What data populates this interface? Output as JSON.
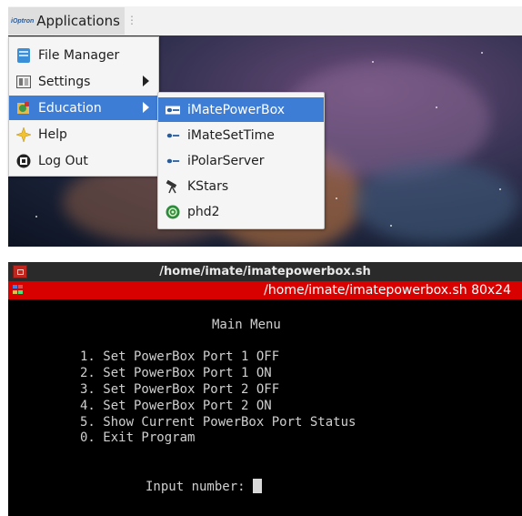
{
  "panel": {
    "logo_text": "iOptron",
    "applications_label": "Applications",
    "grip": "⋮"
  },
  "main_menu": {
    "items": [
      {
        "label": "File Manager",
        "icon": "file-manager-icon"
      },
      {
        "label": "Settings",
        "icon": "settings-icon",
        "has_submenu": true
      },
      {
        "label": "Education",
        "icon": "education-icon",
        "has_submenu": true,
        "highlighted": true
      },
      {
        "label": "Help",
        "icon": "help-icon"
      },
      {
        "label": "Log Out",
        "icon": "log-out-icon"
      }
    ]
  },
  "education_menu": {
    "items": [
      {
        "label": "iMatePowerBox",
        "icon": "imate-icon",
        "highlighted": true
      },
      {
        "label": "iMateSetTime",
        "icon": "imate-icon"
      },
      {
        "label": "iPolarServer",
        "icon": "imate-icon"
      },
      {
        "label": "KStars",
        "icon": "telescope-icon"
      },
      {
        "label": "phd2",
        "icon": "phd2-icon"
      }
    ]
  },
  "terminal": {
    "window_title": "/home/imate/imatepowerbox.sh",
    "tab_title": "/home/imate/imatepowerbox.sh 80x24",
    "lines": {
      "menu_title": "Main Menu",
      "opt1": "1. Set PowerBox Port 1 OFF",
      "opt2": "2. Set PowerBox Port 1 ON",
      "opt3": "3. Set PowerBox Port 2 OFF",
      "opt4": "4. Set PowerBox Port 2 ON",
      "opt5": "5. Show Current PowerBox Port Status",
      "opt0": "0. Exit Program",
      "prompt": "Input number: "
    }
  },
  "colors": {
    "highlight": "#3d7dd6",
    "terminal_tab": "#d90000",
    "terminal_bg": "#000000"
  }
}
